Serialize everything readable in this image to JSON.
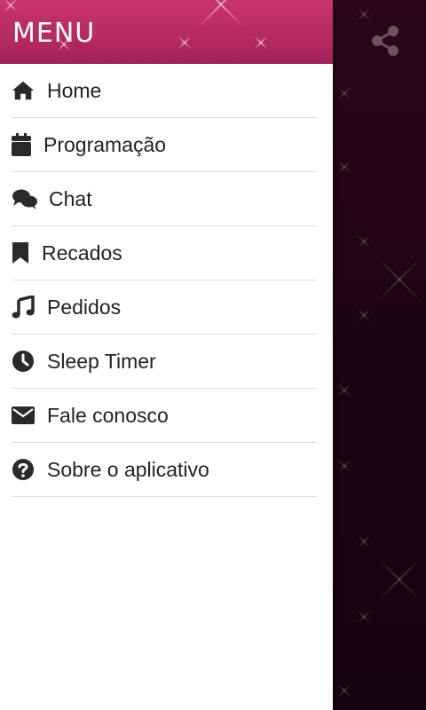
{
  "menu": {
    "title": "MENU",
    "items": [
      {
        "label": "Home",
        "icon": "home-icon"
      },
      {
        "label": "Programação",
        "icon": "calendar-icon"
      },
      {
        "label": "Chat",
        "icon": "chat-bubbles-icon"
      },
      {
        "label": "Recados",
        "icon": "bookmark-icon"
      },
      {
        "label": "Pedidos",
        "icon": "music-note-icon"
      },
      {
        "label": "Sleep Timer",
        "icon": "clock-icon"
      },
      {
        "label": "Fale conosco",
        "icon": "envelope-icon"
      },
      {
        "label": "Sobre o aplicativo",
        "icon": "question-circle-icon"
      }
    ]
  },
  "background": {
    "share_icon": "share-icon"
  },
  "colors": {
    "header_pink": "#b52a5f",
    "background_dark": "#1b0410",
    "icon_dark": "#2a2a2a",
    "divider": "#dcdcdc"
  }
}
